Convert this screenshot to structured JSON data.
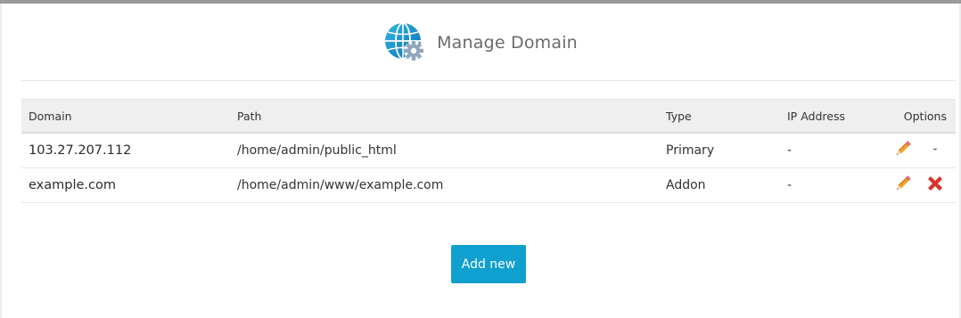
{
  "page": {
    "title": "Manage Domain",
    "title_icon": "globe-gear-icon"
  },
  "table": {
    "headers": {
      "domain": "Domain",
      "path": "Path",
      "type": "Type",
      "ip": "IP Address",
      "options": "Options"
    },
    "rows": [
      {
        "domain": "103.27.207.112",
        "path": "/home/admin/public_html",
        "type": "Primary",
        "ip": "-",
        "edit_icon": "pencil-icon",
        "delete": "-"
      },
      {
        "domain": "example.com",
        "path": "/home/admin/www/example.com",
        "type": "Addon",
        "ip": "-",
        "edit_icon": "pencil-icon",
        "delete_icon": "close-x-icon"
      }
    ]
  },
  "actions": {
    "add_new_label": "Add new"
  },
  "colors": {
    "accent": "#0fa0cf",
    "edit": "#e89a2c",
    "delete": "#d9342b",
    "header_bg": "#efefef"
  }
}
